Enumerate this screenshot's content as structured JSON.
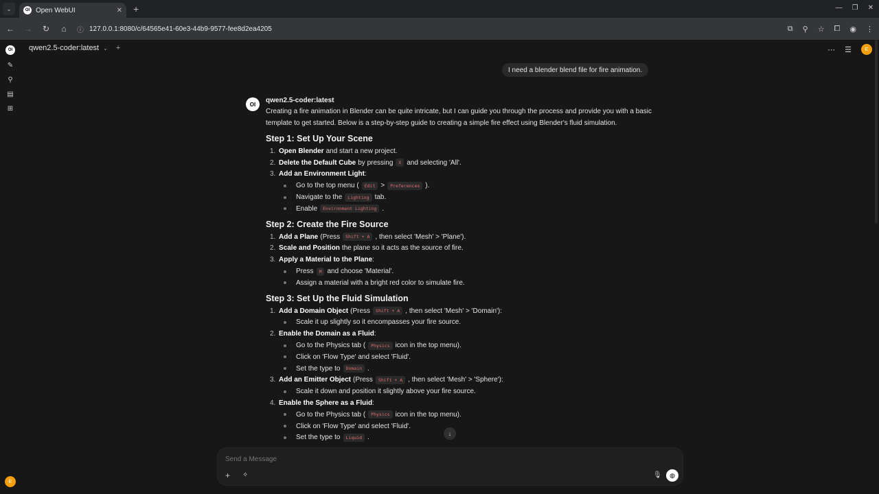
{
  "browser": {
    "tab_title": "Open WebUI",
    "url": "127.0.0.1:8080/c/64565e41-60e3-44b9-9577-fee8d2ea4205"
  },
  "header": {
    "model": "qwen2.5-coder:latest",
    "avatar_initial": "E"
  },
  "user_message": "I need a blender blend file for fire animation.",
  "assistant": {
    "logo": "OI",
    "name": "qwen2.5-coder:latest",
    "intro": "Creating a fire animation in Blender can be quite intricate, but I can guide you through the process and provide you with a basic template to get started. Below is a step-by-step guide to creating a simple fire effect using Blender's fluid simulation.",
    "sections": [
      {
        "heading": "Step 1: Set Up Your Scene",
        "items": [
          {
            "num": "1.",
            "bold": "Open Blender",
            "pre": "",
            "code": "",
            "post": "and start a new project.",
            "subs": []
          },
          {
            "num": "2.",
            "bold": "Delete the Default Cube",
            "pre": "by pressing",
            "code": "X",
            "post": "and selecting 'All'.",
            "subs": []
          },
          {
            "num": "3.",
            "bold": "Add an Environment Light",
            "pre": "",
            "code": "",
            "post": ":",
            "subs": [
              {
                "pre": "Go to the top menu (",
                "code": "Edit",
                "mid": ">",
                "code2": "Preferences",
                "post": ")."
              },
              {
                "pre": "Navigate to the",
                "code": "Lighting",
                "mid": "",
                "code2": "",
                "post": "tab."
              },
              {
                "pre": "Enable",
                "code": "Environment Lighting",
                "mid": "",
                "code2": "",
                "post": "."
              }
            ]
          }
        ]
      },
      {
        "heading": "Step 2: Create the Fire Source",
        "items": [
          {
            "num": "1.",
            "bold": "Add a Plane",
            "pre": "(Press",
            "code": "Shift + A",
            "post": ", then select 'Mesh' > 'Plane').",
            "subs": []
          },
          {
            "num": "2.",
            "bold": "Scale and Position",
            "pre": "",
            "code": "",
            "post": "the plane so it acts as the source of fire.",
            "subs": []
          },
          {
            "num": "3.",
            "bold": "Apply a Material to the Plane",
            "pre": "",
            "code": "",
            "post": ":",
            "subs": [
              {
                "pre": "Press",
                "code": "M",
                "mid": "",
                "code2": "",
                "post": "and choose 'Material'."
              },
              {
                "pre": "Assign a material with a bright red color to simulate fire.",
                "code": "",
                "mid": "",
                "code2": "",
                "post": ""
              }
            ]
          }
        ]
      },
      {
        "heading": "Step 3: Set Up the Fluid Simulation",
        "items": [
          {
            "num": "1.",
            "bold": "Add a Domain Object",
            "pre": "(Press",
            "code": "Shift + A",
            "post": ", then select 'Mesh' > 'Domain'):",
            "subs": [
              {
                "pre": "Scale it up slightly so it encompasses your fire source.",
                "code": "",
                "mid": "",
                "code2": "",
                "post": ""
              }
            ]
          },
          {
            "num": "2.",
            "bold": "Enable the Domain as a Fluid",
            "pre": "",
            "code": "",
            "post": ":",
            "subs": [
              {
                "pre": "Go to the Physics tab (",
                "code": "Physics",
                "mid": "",
                "code2": "",
                "post": "icon in the top menu)."
              },
              {
                "pre": "Click on 'Flow Type' and select 'Fluid'.",
                "code": "",
                "mid": "",
                "code2": "",
                "post": ""
              },
              {
                "pre": "Set the type to",
                "code": "Domain",
                "mid": "",
                "code2": "",
                "post": "."
              }
            ]
          },
          {
            "num": "3.",
            "bold": "Add an Emitter Object",
            "pre": "(Press",
            "code": "Shift + A",
            "post": ", then select 'Mesh' > 'Sphere'):",
            "subs": [
              {
                "pre": "Scale it down and position it slightly above your fire source.",
                "code": "",
                "mid": "",
                "code2": "",
                "post": ""
              }
            ]
          },
          {
            "num": "4.",
            "bold": "Enable the Sphere as a Fluid",
            "pre": "",
            "code": "",
            "post": ":",
            "subs": [
              {
                "pre": "Go to the Physics tab (",
                "code": "Physics",
                "mid": "",
                "code2": "",
                "post": "icon in the top menu)."
              },
              {
                "pre": "Click on 'Flow Type' and select 'Fluid'.",
                "code": "",
                "mid": "",
                "code2": "",
                "post": ""
              },
              {
                "pre": "Set the type to",
                "code": "Liquid",
                "mid": "",
                "code2": "",
                "post": "."
              }
            ]
          }
        ]
      }
    ]
  },
  "composer": {
    "placeholder": "Send a Message"
  }
}
